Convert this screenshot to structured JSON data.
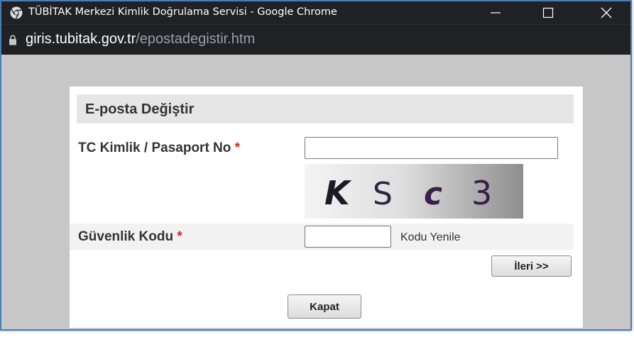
{
  "window": {
    "title": "TÜBİTAK Merkezi Kimlik Doğrulama Servisi - Google Chrome",
    "controls": {
      "minimize": "minimize",
      "maximize": "maximize",
      "close": "close"
    }
  },
  "addressbar": {
    "host": "giris.tubitak.gov.tr",
    "path": "/epostadegistir.htm"
  },
  "form": {
    "header": "E-posta Değiştir",
    "tc_label": "TC Kimlik / Pasaport No",
    "required_mark": "*",
    "tc_value": "",
    "captcha_text": "KSc3",
    "security_label": "Güvenlik Kodu",
    "security_value": "",
    "refresh_label": "Kodu Yenile",
    "next_button": "İleri >>",
    "close_button": "Kapat"
  },
  "colors": {
    "titlebar": "#202124",
    "window_bg": "#c7c7c7",
    "required": "#d9251d",
    "header_bg": "#e6e6e6"
  },
  "icons": [
    "chrome-icon",
    "lock-icon",
    "minimize-icon",
    "maximize-icon",
    "close-icon"
  ]
}
